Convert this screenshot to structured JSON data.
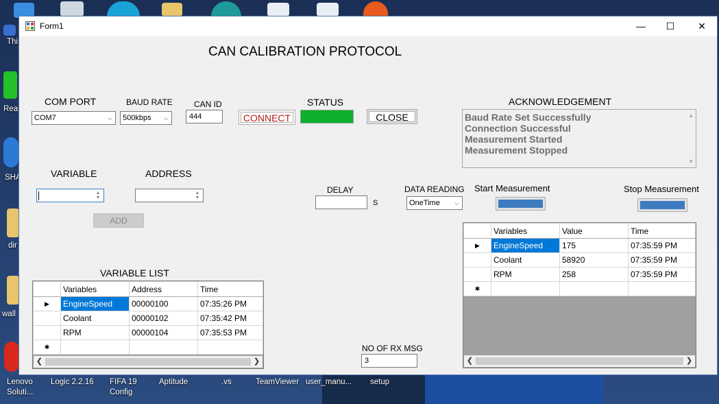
{
  "window": {
    "title": "Form1",
    "minimize": "—",
    "maximize": "☐",
    "close": "✕"
  },
  "heading": "CAN CALIBRATION PROTOCOL",
  "com_port": {
    "label": "COM PORT",
    "value": "COM7"
  },
  "baud_rate": {
    "label": "BAUD RATE",
    "value": "500kbps"
  },
  "can_id": {
    "label": "CAN ID",
    "value": "444"
  },
  "connect_label": "CONNECT",
  "status": {
    "label": "STATUS",
    "color": "#0db02b"
  },
  "close_label": "CLOSE",
  "acknowledgement": {
    "label": "ACKNOWLEDGEMENT",
    "lines": [
      "Baud Rate Set Successfully",
      "Connection Successful",
      "Measurement Started",
      "Measurement Stopped"
    ]
  },
  "variable_label": "VARIABLE",
  "address_label": "ADDRESS",
  "add_label": "ADD",
  "delay": {
    "label": "DELAY",
    "unit": "S",
    "value": ""
  },
  "data_reading": {
    "label": "DATA READING",
    "value": "OneTime"
  },
  "start_measurement": {
    "label": "Start Measurement",
    "color": "#3c7bc0"
  },
  "stop_measurement": {
    "label": "Stop Measurement",
    "color": "#3c7bc0"
  },
  "variable_list": {
    "title": "VARIABLE LIST",
    "headers": [
      "Variables",
      "Address",
      "Time"
    ],
    "rows": [
      [
        "EngineSpeed",
        "00000100",
        "07:35:26 PM"
      ],
      [
        "Coolant",
        "00000102",
        "07:35:42 PM"
      ],
      [
        "RPM",
        "00000104",
        "07:35:53 PM"
      ]
    ]
  },
  "rx_msg": {
    "label": "NO OF RX MSG",
    "value": "3"
  },
  "measurement_grid": {
    "headers": [
      "Variables",
      "Value",
      "Time"
    ],
    "rows": [
      [
        "EngineSpeed",
        "175",
        "07:35:59 PM"
      ],
      [
        "Coolant",
        "58920",
        "07:35:59 PM"
      ],
      [
        "RPM",
        "258",
        "07:35:59 PM"
      ]
    ]
  },
  "desktop": {
    "left_labels": [
      "Thi",
      "Rea",
      "SHA",
      "dir",
      "wall"
    ],
    "taskbar_labels": [
      "Lenovo Soluti...",
      "Logic 2.2.16",
      "FIFA 19 Config",
      "Aptitude",
      ".vs",
      "TeamViewer",
      "user_manu...",
      "setup"
    ]
  }
}
